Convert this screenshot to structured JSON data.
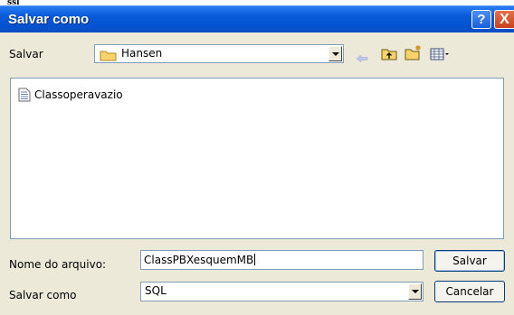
{
  "dialog": {
    "title": "Salvar como",
    "help_glyph": "?",
    "close_glyph": "X"
  },
  "location": {
    "label": "Salvar",
    "folder": "Hansen",
    "folder_icon": "folder-icon"
  },
  "toolbar": {
    "icons": [
      "back-arrow-icon",
      "up-folder-icon",
      "new-folder-icon",
      "view-menu-icon"
    ]
  },
  "files": [
    {
      "name": "Classoperavazio",
      "icon": "document-icon"
    }
  ],
  "filename": {
    "label": "Nome do arquivo:",
    "value": "ClassPBXesquemMB"
  },
  "filetype": {
    "label": "Salvar como",
    "value": "SQL"
  },
  "buttons": {
    "save": "Salvar",
    "cancel": "Cancelar"
  },
  "colors": {
    "titlebar": "#0a5bd8",
    "dialog_bg": "#ece9d8",
    "close_button": "#c9401c"
  }
}
